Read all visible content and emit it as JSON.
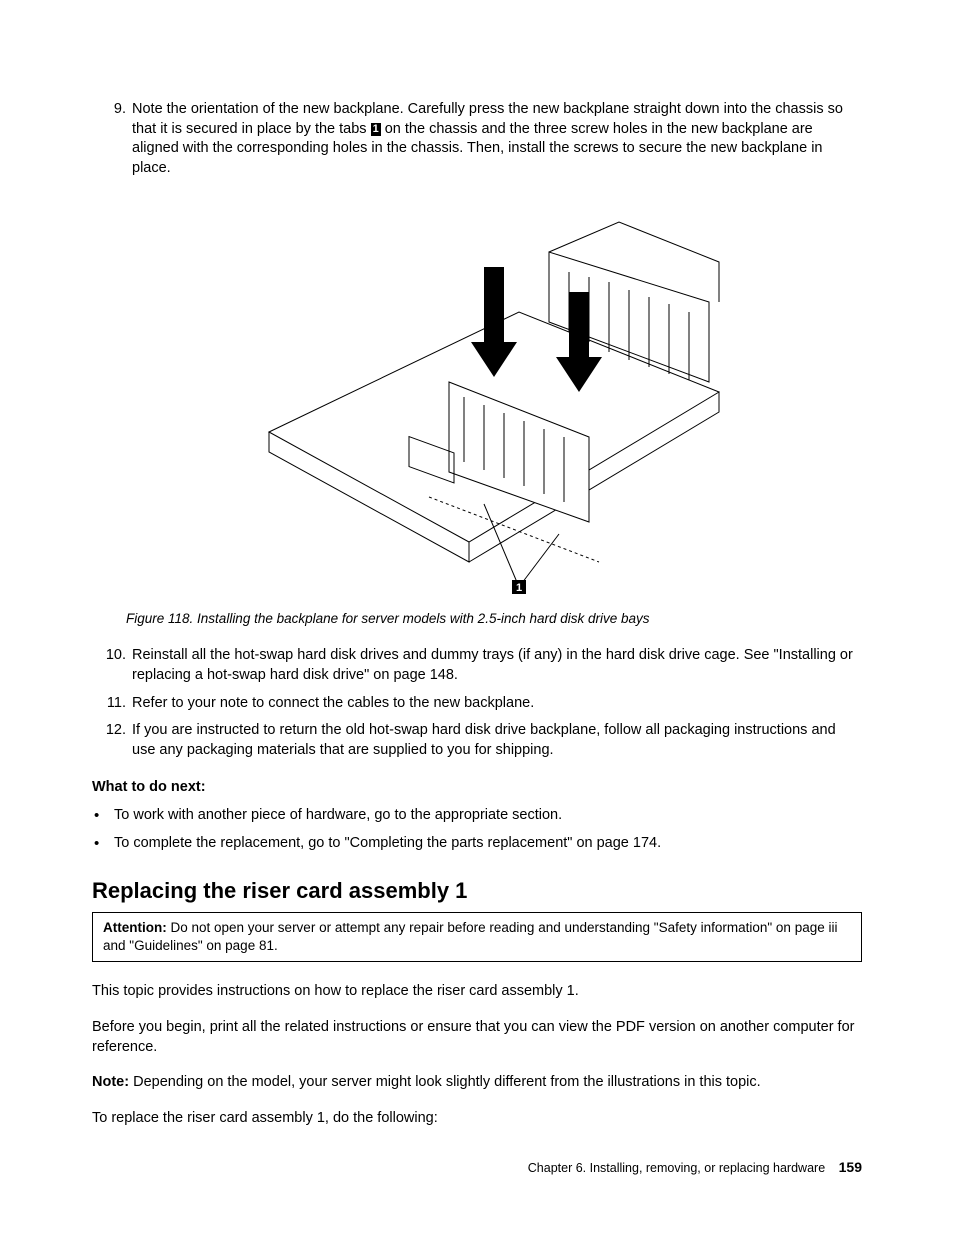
{
  "steps": {
    "s9": {
      "num": "9.",
      "text_a": "Note the orientation of the new backplane. Carefully press the new backplane straight down into the chassis so that it is secured in place by the tabs ",
      "callout": "1",
      "text_b": " on the chassis and the three screw holes in the new backplane are aligned with the corresponding holes in the chassis. Then, install the screws to secure the new backplane in place."
    },
    "s10": {
      "num": "10.",
      "text": "Reinstall all the hot-swap hard disk drives and dummy trays (if any) in the hard disk drive cage. See \"Installing or replacing a hot-swap hard disk drive\" on page 148."
    },
    "s11": {
      "num": "11.",
      "text": "Refer to your note to connect the cables to the new backplane."
    },
    "s12": {
      "num": "12.",
      "text": "If you are instructed to return the old hot-swap hard disk drive backplane, follow all packaging instructions and use any packaging materials that are supplied to you for shipping."
    }
  },
  "figure": {
    "label": "Figure 118. ",
    "caption": "Installing the backplane for server models with 2.5-inch hard disk drive bays",
    "callout": "1"
  },
  "what_next": {
    "heading": "What to do next:",
    "items": [
      "To work with another piece of hardware, go to the appropriate section.",
      "To complete the replacement, go to \"Completing the parts replacement\" on page 174."
    ]
  },
  "section": {
    "title": "Replacing the riser card assembly 1",
    "attention_lead": "Attention: ",
    "attention_text": "Do not open your server or attempt any repair before reading and understanding \"Safety information\" on page iii and \"Guidelines\" on page 81.",
    "p1": "This topic provides instructions on how to replace the riser card assembly 1.",
    "p2": "Before you begin, print all the related instructions or ensure that you can view the PDF version on another computer for reference.",
    "note_lead": "Note: ",
    "note_text": "Depending on the model, your server might look slightly different from the illustrations in this topic.",
    "p3": "To replace the riser card assembly 1, do the following:"
  },
  "footer": {
    "chapter": "Chapter 6. Installing, removing, or replacing hardware",
    "page": "159"
  }
}
